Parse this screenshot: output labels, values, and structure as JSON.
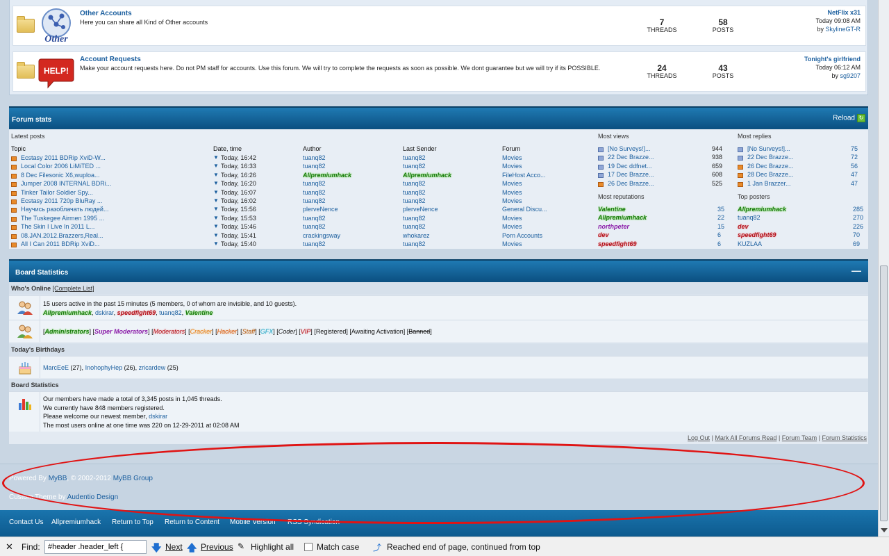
{
  "forums": [
    {
      "title": "Other Accounts",
      "description": "Here you can share all Kind of Other accounts",
      "icon_text": "Other",
      "threads": "7",
      "threads_label": "THREADS",
      "posts": "58",
      "posts_label": "POSTS",
      "lastpost_title": "NetFlix x31",
      "lastpost_time": "Today 09:08 AM",
      "lastpost_by": "by",
      "lastpost_user": "SkylineGT-R"
    },
    {
      "title": "Account Requests",
      "description": "Make your account requests here. Do not PM staff for accounts. Use this forum. We will try to complete the requests as soon as possible. We dont guarantee but we will try if its POSSIBLE.",
      "icon_text": "HELP!",
      "threads": "24",
      "threads_label": "THREADS",
      "posts": "43",
      "posts_label": "POSTS",
      "lastpost_title": "Tonight's girlfriend",
      "lastpost_time": "Today 06:12 AM",
      "lastpost_by": "by",
      "lastpost_user": "sg9207"
    }
  ],
  "forum_stats": {
    "title": "Forum stats",
    "reload": "Reload",
    "latest_posts_label": "Latest posts",
    "most_views_label": "Most views",
    "most_replies_label": "Most replies",
    "most_reputations_label": "Most reputations",
    "top_posters_label": "Top posters",
    "columns": [
      "Topic",
      "Date, time",
      "Author",
      "Last Sender",
      "Forum"
    ],
    "latest": [
      {
        "topic": "Ecstasy 2011 BDRip XviD-W...",
        "time": "Today, 16:42",
        "author": "tuanq82",
        "sender": "tuanq82",
        "forum": "Movies"
      },
      {
        "topic": "Local Color 2006 LiMiTED ...",
        "time": "Today, 16:33",
        "author": "tuanq82",
        "sender": "tuanq82",
        "forum": "Movies"
      },
      {
        "topic": "8 Dec Filesonic X6,wuploa...",
        "time": "Today, 16:26",
        "author": "Allpremiumhack",
        "sender": "Allpremiumhack",
        "forum": "FileHost Acco..."
      },
      {
        "topic": "Jumper 2008 INTERNAL BDRi...",
        "time": "Today, 16:20",
        "author": "tuanq82",
        "sender": "tuanq82",
        "forum": "Movies"
      },
      {
        "topic": "Tinker Tailor Soldier Spy...",
        "time": "Today, 16:07",
        "author": "tuanq82",
        "sender": "tuanq82",
        "forum": "Movies"
      },
      {
        "topic": "Ecstasy 2011 720p BluRay ...",
        "time": "Today, 16:02",
        "author": "tuanq82",
        "sender": "tuanq82",
        "forum": "Movies"
      },
      {
        "topic": "Научись разоблачать людей...",
        "time": "Today, 15:56",
        "author": "plerveNence",
        "sender": "plerveNence",
        "forum": "General Discu..."
      },
      {
        "topic": "The Tuskegee Airmen 1995 ...",
        "time": "Today, 15:53",
        "author": "tuanq82",
        "sender": "tuanq82",
        "forum": "Movies"
      },
      {
        "topic": "The Skin I Live In 2011 L...",
        "time": "Today, 15:46",
        "author": "tuanq82",
        "sender": "tuanq82",
        "forum": "Movies"
      },
      {
        "topic": "08.JAN.2012.Brazzers,Real...",
        "time": "Today, 15:41",
        "author": "crackingsway",
        "sender": "whokarez",
        "forum": "Porn Accounts"
      },
      {
        "topic": "All I Can 2011 BDRip XviD...",
        "time": "Today, 15:40",
        "author": "tuanq82",
        "sender": "tuanq82",
        "forum": "Movies"
      }
    ],
    "most_views": [
      {
        "topic": "[No Surveys!]...",
        "count": "944"
      },
      {
        "topic": "22 Dec Brazze...",
        "count": "938"
      },
      {
        "topic": "19 Dec ddfnet...",
        "count": "659"
      },
      {
        "topic": "17 Dec Brazze...",
        "count": "608"
      },
      {
        "topic": "26 Dec Brazze...",
        "count": "525"
      }
    ],
    "most_replies": [
      {
        "topic": "[No Surveys!]...",
        "count": "75"
      },
      {
        "topic": "22 Dec Brazze...",
        "count": "72"
      },
      {
        "topic": "26 Dec Brazze...",
        "count": "56"
      },
      {
        "topic": "28 Dec Brazze...",
        "count": "47"
      },
      {
        "topic": "1 Jan Brazzer...",
        "count": "47"
      }
    ],
    "most_reputations": [
      {
        "user": "Valentine",
        "count": "35"
      },
      {
        "user": "Allpremiumhack",
        "count": "22"
      },
      {
        "user": "northpeter",
        "count": "15"
      },
      {
        "user": "dev",
        "count": "6"
      },
      {
        "user": "speedfight69",
        "count": "6"
      }
    ],
    "top_posters": [
      {
        "user": "Allpremiumhack",
        "count": "285"
      },
      {
        "user": "tuanq82",
        "count": "270"
      },
      {
        "user": "dev",
        "count": "226"
      },
      {
        "user": "speedfight69",
        "count": "70"
      },
      {
        "user": "KUZLAA",
        "count": "69"
      }
    ]
  },
  "board_stats": {
    "title": "Board Statistics",
    "collapse": "—",
    "whos_online_label": "Who's Online",
    "complete_list": "[Complete List]",
    "online_summary": "15 users active in the past 15 minutes (5 members, 0 of whom are invisible, and 10 guests).",
    "online_users": [
      "Allpremiumhack",
      "dskirar",
      "speedfight69",
      "tuanq82",
      "Valentine"
    ],
    "groups": [
      "Administrators",
      "Super Moderators",
      "Moderators",
      "Cracker",
      "Hacker",
      "Staff",
      "GFX",
      "Coder",
      "VIP",
      "Registered",
      "Awaiting Activation",
      "Banned"
    ],
    "birthdays_label": "Today's Birthdays",
    "birthdays": [
      {
        "user": "MarcEeE",
        "age": "(27)"
      },
      {
        "user": "InohophyHep",
        "age": "(26)"
      },
      {
        "user": "zricardew",
        "age": "(25)"
      }
    ],
    "stats_label": "Board Statistics",
    "stats_line1": "Our members have made a total of 3,345 posts in 1,045 threads.",
    "stats_line2": "We currently have 848 members registered.",
    "stats_line3_prefix": "Please welcome our newest member,",
    "newest_member": "dskirar",
    "stats_line4": "The most users online at one time was 220 on 12-29-2011 at 02:08 AM",
    "links": [
      "Log Out",
      "Mark All Forums Read",
      "Forum Team",
      "Forum Statistics"
    ]
  },
  "footer": {
    "powered_prefix": "Powered By",
    "powered_link": "MyBB",
    "powered_suffix": ", © 2002-2012",
    "powered_group": "MyBB Group",
    "theme_prefix": "Custom Theme by",
    "theme_link": "Audentio Design",
    "nav": [
      "Contact Us",
      "Allpremiumhack",
      "Return to Top",
      "Return to Content",
      "Mobile Version",
      "RSS Syndication"
    ]
  },
  "findbar": {
    "close": "✕",
    "find_label": "Find:",
    "query": "#header .header_left {",
    "next": "Next",
    "previous": "Previous",
    "highlight": "Highlight all",
    "match_case": "Match case",
    "status": "Reached end of page, continued from top"
  },
  "colors": {
    "header_blue": "#0b4f80",
    "link": "#1a5e9e",
    "annotation_red": "#e01414"
  }
}
